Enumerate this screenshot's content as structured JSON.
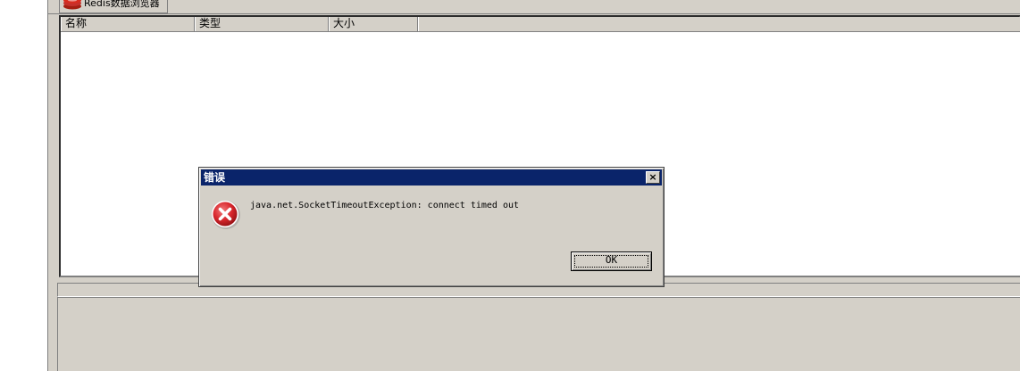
{
  "tab": {
    "label": "Redis数据浏览器",
    "icon": "redis-icon"
  },
  "table": {
    "columns": [
      "名称",
      "类型",
      "大小"
    ],
    "rows": []
  },
  "dialog": {
    "title": "错误",
    "message": "java.net.SocketTimeoutException: connect timed out",
    "ok_label": "OK",
    "close_label": "×",
    "icon": "error-icon"
  },
  "colors": {
    "titlebar": "#0a246a",
    "window_bg": "#d4d0c8",
    "error_red": "#d8262c"
  }
}
